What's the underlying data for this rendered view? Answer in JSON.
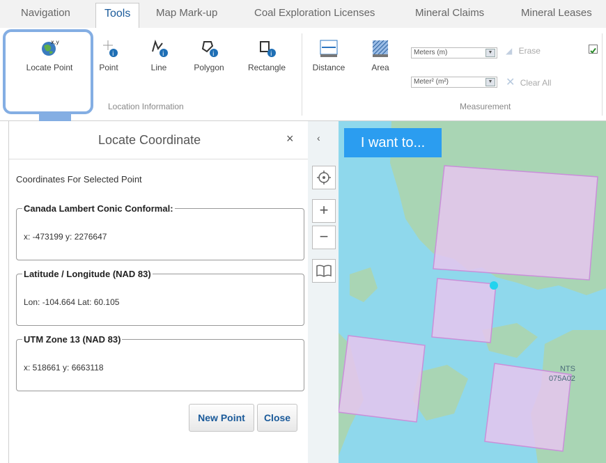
{
  "tabs": [
    {
      "label": "Navigation",
      "active": false
    },
    {
      "label": "Tools",
      "active": true
    },
    {
      "label": "Map Mark-up",
      "active": false
    },
    {
      "label": "Coal Exploration Licenses",
      "active": false
    },
    {
      "label": "Mineral Claims",
      "active": false
    },
    {
      "label": "Mineral Leases",
      "active": false
    }
  ],
  "ribbon": {
    "tools": {
      "locate_point": "Locate Point",
      "point": "Point",
      "line": "Line",
      "polygon": "Polygon",
      "rectangle": "Rectangle",
      "distance": "Distance",
      "area": "Area"
    },
    "location_group": "Location Information",
    "measurement_group": "Measurement",
    "length_unit": "Meters (m)",
    "area_unit": "Meter² (m²)",
    "erase": "Erase",
    "clear_all": "Clear All",
    "checkbox_checked": true
  },
  "panel": {
    "title": "Locate Coordinate",
    "close_icon": "×",
    "subtitle": "Coordinates For Selected Point",
    "lambert": {
      "legend": "Canada Lambert Conic Conformal:",
      "value": "x: -473199 y: 2276647"
    },
    "latlon": {
      "legend": "Latitude / Longitude (NAD 83)",
      "value": "Lon: -104.664 Lat: 60.105"
    },
    "utm": {
      "legend": "UTM Zone 13 (NAD 83)",
      "value": "x: 518661 y: 6663118"
    },
    "new_point": "New Point",
    "close": "Close"
  },
  "map": {
    "collapse_icon": "‹",
    "i_want_to": "I want to...",
    "zoom_in": "+",
    "zoom_out": "−",
    "nts_line1": "NTS",
    "nts_line2": "075A02"
  },
  "colors": {
    "accent": "#2b9df0",
    "callout": "#84aee3",
    "water": "#8fd8ec",
    "land": "#a9d5b4",
    "claim_fill": "#e6c6ef",
    "claim_stroke": "#c98fd9",
    "point": "#22d3ee"
  }
}
